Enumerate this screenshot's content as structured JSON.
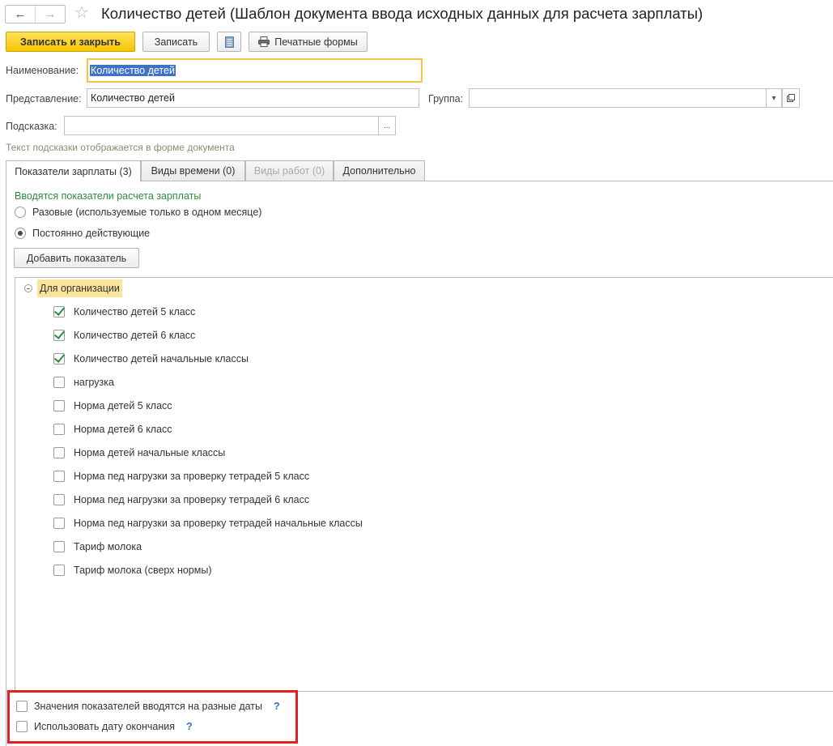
{
  "header": {
    "back_icon": "arrow-left-icon",
    "forward_icon": "arrow-right-icon",
    "favorite_icon": "star-icon",
    "title": "Количество детей (Шаблон документа ввода исходных данных для расчета зарплаты)"
  },
  "toolbar": {
    "save_close_label": "Записать и закрыть",
    "save_label": "Записать",
    "list_icon": "document-list-icon",
    "print_icon": "printer-icon",
    "print_label": "Печатные формы"
  },
  "form": {
    "name_label": "Наименование:",
    "name_value": "Количество детей",
    "representation_label": "Представление:",
    "representation_value": "Количество детей",
    "group_label": "Группа:",
    "group_value": "",
    "hint_label": "Подсказка:",
    "hint_value": "",
    "hint_note": "Текст подсказки отображается в форме документа"
  },
  "tabs": [
    {
      "label": "Показатели зарплаты (3)",
      "active": true,
      "enabled": true
    },
    {
      "label": "Виды времени (0)",
      "active": false,
      "enabled": true
    },
    {
      "label": "Виды работ (0)",
      "active": false,
      "enabled": false
    },
    {
      "label": "Дополнительно",
      "active": false,
      "enabled": true
    }
  ],
  "indicators": {
    "heading": "Вводятся показатели расчета зарплаты",
    "radio_options": [
      {
        "label": "Разовые (используемые только в одном месяце)",
        "selected": false
      },
      {
        "label": "Постоянно действующие",
        "selected": true
      }
    ],
    "add_button_label": "Добавить показатель",
    "group_label": "Для организации",
    "items": [
      {
        "label": "Количество детей 5 класс",
        "checked": true
      },
      {
        "label": "Количество детей 6 класс",
        "checked": true
      },
      {
        "label": "Количество детей начальные классы",
        "checked": true
      },
      {
        "label": "нагрузка",
        "checked": false
      },
      {
        "label": "Норма детей 5 класс",
        "checked": false
      },
      {
        "label": "Норма детей 6 класс",
        "checked": false
      },
      {
        "label": "Норма детей начальные классы",
        "checked": false
      },
      {
        "label": "Норма пед нагрузки за проверку тетрадей 5 класс",
        "checked": false
      },
      {
        "label": "Норма пед нагрузки за проверку тетрадей 6 класс",
        "checked": false
      },
      {
        "label": "Норма пед нагрузки за проверку тетрадей начальные классы",
        "checked": false
      },
      {
        "label": "Тариф молока",
        "checked": false
      },
      {
        "label": "Тариф молока (сверх нормы)",
        "checked": false
      }
    ]
  },
  "options": [
    {
      "label": "Значения показателей вводятся на разные даты",
      "checked": false,
      "help": "?"
    },
    {
      "label": "Использовать дату окончания",
      "checked": false,
      "help": "?"
    }
  ],
  "colors": {
    "primary_button": "#f6c500",
    "heading_green": "#2e8b3d",
    "highlight_box": "#e52020",
    "group_highlight": "#fbe39a"
  }
}
